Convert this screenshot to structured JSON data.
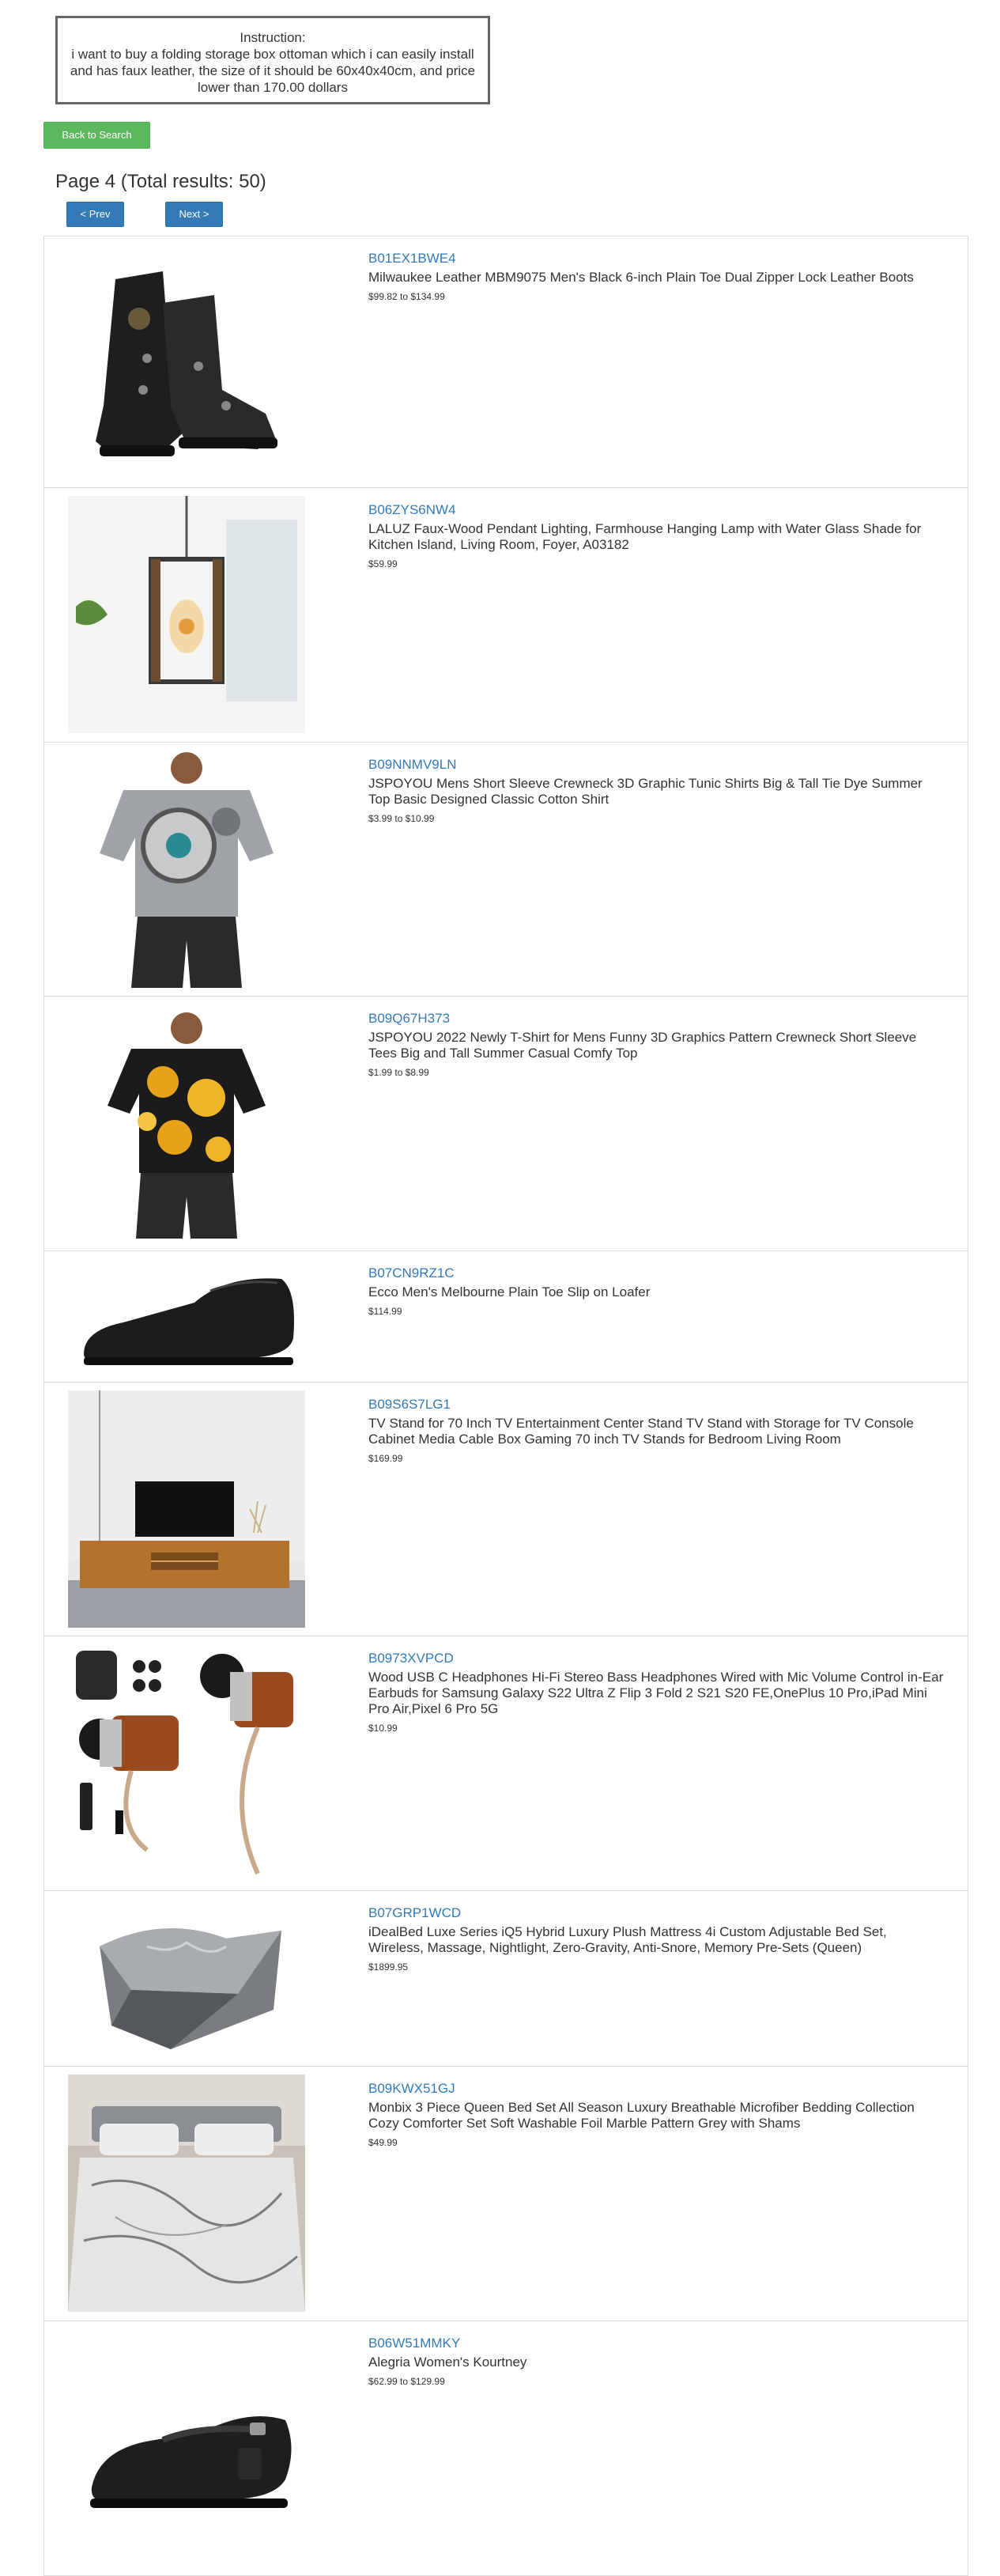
{
  "instruction": {
    "heading": "Instruction:",
    "text": "i want to buy a folding storage box ottoman which i can easily install and has faux leather, the size of it should be 60x40x40cm, and price lower than 170.00 dollars"
  },
  "back_button": "Back to Search",
  "page_title": "Page 4 (Total results: 50)",
  "pagination": {
    "prev": "< Prev",
    "next": "Next >"
  },
  "products": [
    {
      "asin": "B01EX1BWE4",
      "title": "Milwaukee Leather MBM9075 Men's Black 6-inch Plain Toe Dual Zipper Lock Leather Boots",
      "price": "$99.82 to $134.99",
      "image": "boot"
    },
    {
      "asin": "B06ZYS6NW4",
      "title": "LALUZ Faux-Wood Pendant Lighting, Farmhouse Hanging Lamp with Water Glass Shade for Kitchen Island, Living Room, Foyer, A03182",
      "price": "$59.99",
      "image": "pendant-lamp"
    },
    {
      "asin": "B09NNMV9LN",
      "title": "JSPOYOU Mens Short Sleeve Crewneck 3D Graphic Tunic Shirts Big & Tall Tie Dye Summer Top Basic Designed Classic Cotton Shirt",
      "price": "$3.99 to $10.99",
      "image": "gear-shirt"
    },
    {
      "asin": "B09Q67H373",
      "title": "JSPOYOU 2022 Newly T-Shirt for Mens Funny 3D Graphics Pattern Crewneck Short Sleeve Tees Big and Tall Summer Casual Comfy Top",
      "price": "$1.99 to $8.99",
      "image": "baroque-shirt"
    },
    {
      "asin": "B07CN9RZ1C",
      "title": "Ecco Men's Melbourne Plain Toe Slip on Loafer",
      "price": "$114.99",
      "image": "loafer"
    },
    {
      "asin": "B09S6S7LG1",
      "title": "TV Stand for 70 Inch TV Entertainment Center Stand TV Stand with Storage for TV Console Cabinet Media Cable Box Gaming 70 inch TV Stands for Bedroom Living Room",
      "price": "$169.99",
      "image": "tv-stand"
    },
    {
      "asin": "B0973XVPCD",
      "title": "Wood USB C Headphones Hi-Fi Stereo Bass Headphones Wired with Mic Volume Control in-Ear Earbuds for Samsung Galaxy S22 Ultra Z Flip 3 Fold 2 S21 S20 FE,OnePlus 10 Pro,iPad Mini Pro Air,Pixel 6 Pro 5G",
      "price": "$10.99",
      "image": "earbuds"
    },
    {
      "asin": "B07GRP1WCD",
      "title": "iDealBed Luxe Series iQ5 Hybrid Luxury Plush Mattress 4i Custom Adjustable Bed Set, Wireless, Massage, Nightlight, Zero-Gravity, Anti-Snore, Memory Pre-Sets (Queen)",
      "price": "$1899.95",
      "image": "mattress"
    },
    {
      "asin": "B09KWX51GJ",
      "title": "Monbix 3 Piece Queen Bed Set All Season Luxury Breathable Microfiber Bedding Collection Cozy Comforter Set Soft Washable Foil Marble Pattern Grey with Shams",
      "price": "$49.99",
      "image": "bedding"
    },
    {
      "asin": "B06W51MMKY",
      "title": "Alegria Women's Kourtney",
      "price": "$62.99 to $129.99",
      "image": "mary-jane-shoe"
    }
  ],
  "colors": {
    "link": "#337ab7",
    "back_button": "#5cb85c",
    "nav_button": "#337ab7"
  }
}
